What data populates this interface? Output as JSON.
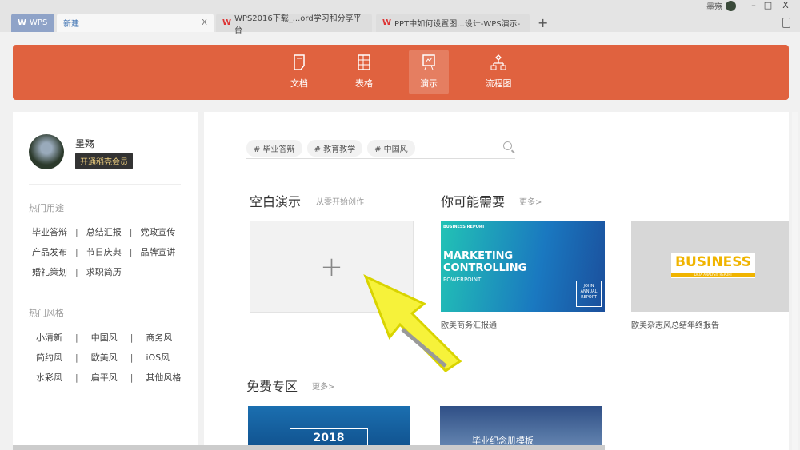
{
  "titlebar": {
    "user": "墨殇",
    "minimize": "–",
    "maximize": "□",
    "close": "X"
  },
  "tabs": [
    {
      "label": "WPS"
    },
    {
      "label": "新建",
      "close": "X"
    },
    {
      "label": "WPS2016下载_...ord学习和分享平台"
    },
    {
      "label": "PPT中如何设置图...设计-WPS演示-"
    }
  ],
  "new_tab": "+",
  "banner": {
    "items": [
      {
        "label": "文档"
      },
      {
        "label": "表格"
      },
      {
        "label": "演示"
      },
      {
        "label": "流程图"
      }
    ],
    "active": "演示",
    "color": "#e0623f"
  },
  "profile": {
    "name": "墨殇",
    "vip_button": "开通稻壳会员"
  },
  "usage": {
    "title": "热门用途",
    "items": [
      "毕业答辩",
      "总结汇报",
      "党政宣传",
      "产品发布",
      "节日庆典",
      "品牌宣讲",
      "婚礼策划",
      "求职简历"
    ]
  },
  "styles": {
    "title": "热门风格",
    "items": [
      "小清新",
      "中国风",
      "商务风",
      "简约风",
      "欧美风",
      "iOS风",
      "水彩风",
      "扁平风",
      "其他风格"
    ]
  },
  "search": {
    "tags": [
      "# 毕业答辩",
      "# 教育教学",
      "# 中国风"
    ]
  },
  "blank": {
    "title": "空白演示",
    "subtitle": "从零开始创作",
    "plus": "+"
  },
  "recommend": {
    "title": "你可能需要",
    "more": "更多>",
    "cards": [
      {
        "caption": "欧美商务汇报通",
        "tag": "BUSINESS REPORT",
        "title1": "MARKETING",
        "title2": "CONTROLLING",
        "sub": "POWERPOINT",
        "box": "JOHN ANNUAL REPORT"
      },
      {
        "caption": "欧美杂志风总结年终报告",
        "title": "BUSINESS",
        "sub": "DATA ANALYSIS REPORT"
      }
    ]
  },
  "free": {
    "title": "免费专区",
    "more": "更多>",
    "cards": [
      {
        "text": "2018"
      },
      {
        "text": "毕业纪念册模板"
      }
    ]
  }
}
